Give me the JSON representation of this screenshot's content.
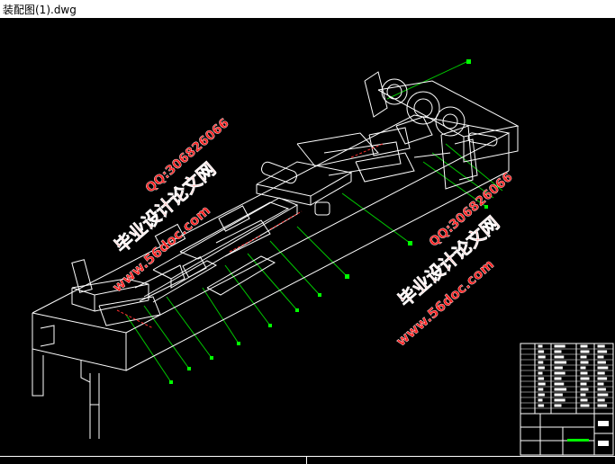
{
  "window": {
    "title": "装配图(1).dwg"
  },
  "drawing": {
    "background": "#000000",
    "line_color": "#ffffff",
    "leader_color": "#00ff00",
    "accent_color": "#ff0000",
    "balloon_count": 11
  },
  "watermarks": {
    "left": {
      "site_name": "毕业设计论文网",
      "url": "www.56doc.com",
      "qq": "QQ:306826066"
    },
    "right": {
      "site_name": "毕业设计论文网",
      "url": "www.56doc.com",
      "qq": "QQ:306826066"
    },
    "color": "#ff2020"
  }
}
